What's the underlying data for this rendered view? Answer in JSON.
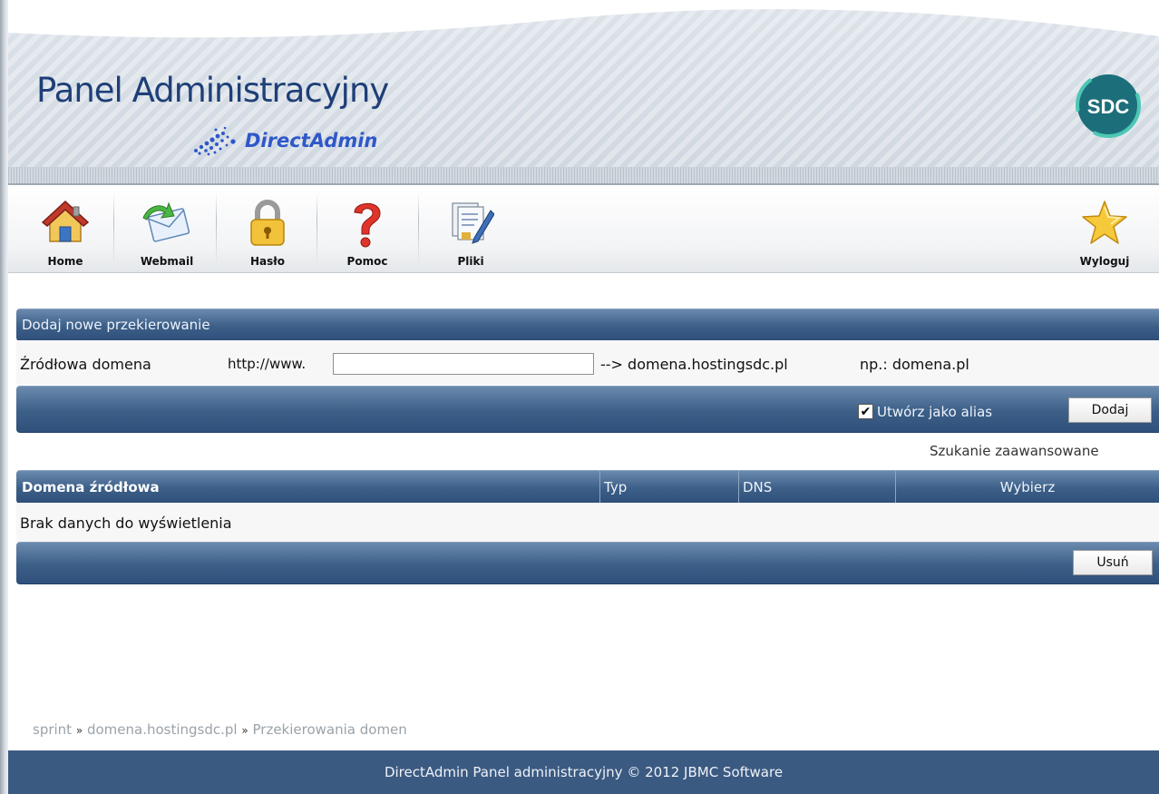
{
  "header": {
    "title": "Panel Administracyjny",
    "subtitle": "DirectAdmin",
    "badge": "SDC"
  },
  "toolbar": {
    "items": [
      {
        "label": "Home",
        "icon": "house-icon"
      },
      {
        "label": "Webmail",
        "icon": "envelope-icon"
      },
      {
        "label": "Hasło",
        "icon": "padlock-icon"
      },
      {
        "label": "Pomoc",
        "icon": "question-mark-icon"
      },
      {
        "label": "Pliki",
        "icon": "files-icon"
      }
    ],
    "logout": {
      "label": "Wyloguj",
      "icon": "star-icon"
    }
  },
  "redirect_form": {
    "section_title": "Dodaj nowe przekierowanie",
    "source_label": "Źródłowa domena",
    "prefix": "http://www.",
    "input_value": "",
    "target_text": "--> domena.hostingsdc.pl",
    "example": "np.: domena.pl",
    "alias_label": "Utwórz jako alias",
    "alias_checked": true,
    "add_button": "Dodaj"
  },
  "advanced_search": "Szukanie zaawansowane",
  "table": {
    "columns": [
      "Domena źródłowa",
      "Typ",
      "DNS",
      "Wybierz"
    ],
    "empty_text": "Brak danych do wyświetlenia",
    "delete_button": "Usuń"
  },
  "breadcrumb": {
    "items": [
      "sprint",
      "domena.hostingsdc.pl",
      "Przekierowania domen"
    ],
    "separator": "»"
  },
  "footer": {
    "text": "DirectAdmin Panel administracyjny © 2012 JBMC Software"
  },
  "colors": {
    "bar_blue": "#3c5f88",
    "title_blue": "#1e3f78",
    "footer_blue": "#3b5a82"
  }
}
